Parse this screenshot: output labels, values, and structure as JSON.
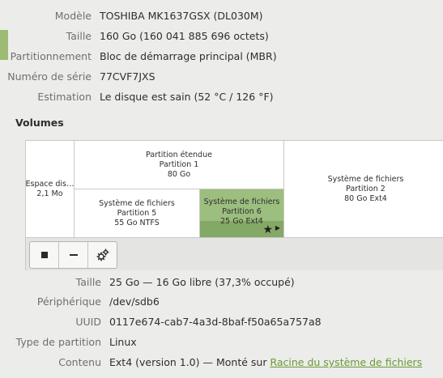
{
  "drive": {
    "model_label": "Modèle",
    "model_value": "TOSHIBA MK1637GSX (DL030M)",
    "size_label": "Taille",
    "size_value": "160 Go (160 041 885 696 octets)",
    "partitioning_label": "Partitionnement",
    "partitioning_value": "Bloc de démarrage principal (MBR)",
    "serial_label": "Numéro de série",
    "serial_value": "77CVF7JXS",
    "assessment_label": "Estimation",
    "assessment_value": "Le disque est sain (52 °C / 126 °F)"
  },
  "volumes": {
    "heading": "Volumes",
    "free_space": {
      "line1": "Espace dis…",
      "line2": "2,1 Mo"
    },
    "extended": {
      "line1": "Partition étendue",
      "line2": "Partition 1",
      "line3": "80 Go"
    },
    "partition5": {
      "line1": "Système de fichiers",
      "line2": "Partition 5",
      "line3": "55 Go NTFS"
    },
    "partition6": {
      "line1": "Système de fichiers",
      "line2": "Partition 6",
      "line3": "25 Go Ext4"
    },
    "partition2": {
      "line1": "Système de fichiers",
      "line2": "Partition 2",
      "line3": "80 Go Ext4"
    },
    "selected_color": "#9cbe7e"
  },
  "toolbar": {
    "stop_icon": "stop-icon",
    "delete_icon": "minus-icon",
    "settings_icon": "gears-icon"
  },
  "selected_volume": {
    "size_label": "Taille",
    "size_value": "25 Go — 16 Go libre (37,3% occupé)",
    "device_label": "Périphérique",
    "device_value": "/dev/sdb6",
    "uuid_label": "UUID",
    "uuid_value": "0117e674-cab7-4a3d-8baf-f50a65a757a8",
    "type_label": "Type de partition",
    "type_value": "Linux",
    "contents_label": "Contenu",
    "contents_prefix": "Ext4 (version 1.0) — Monté sur ",
    "contents_link": "Racine du système de fichiers"
  }
}
